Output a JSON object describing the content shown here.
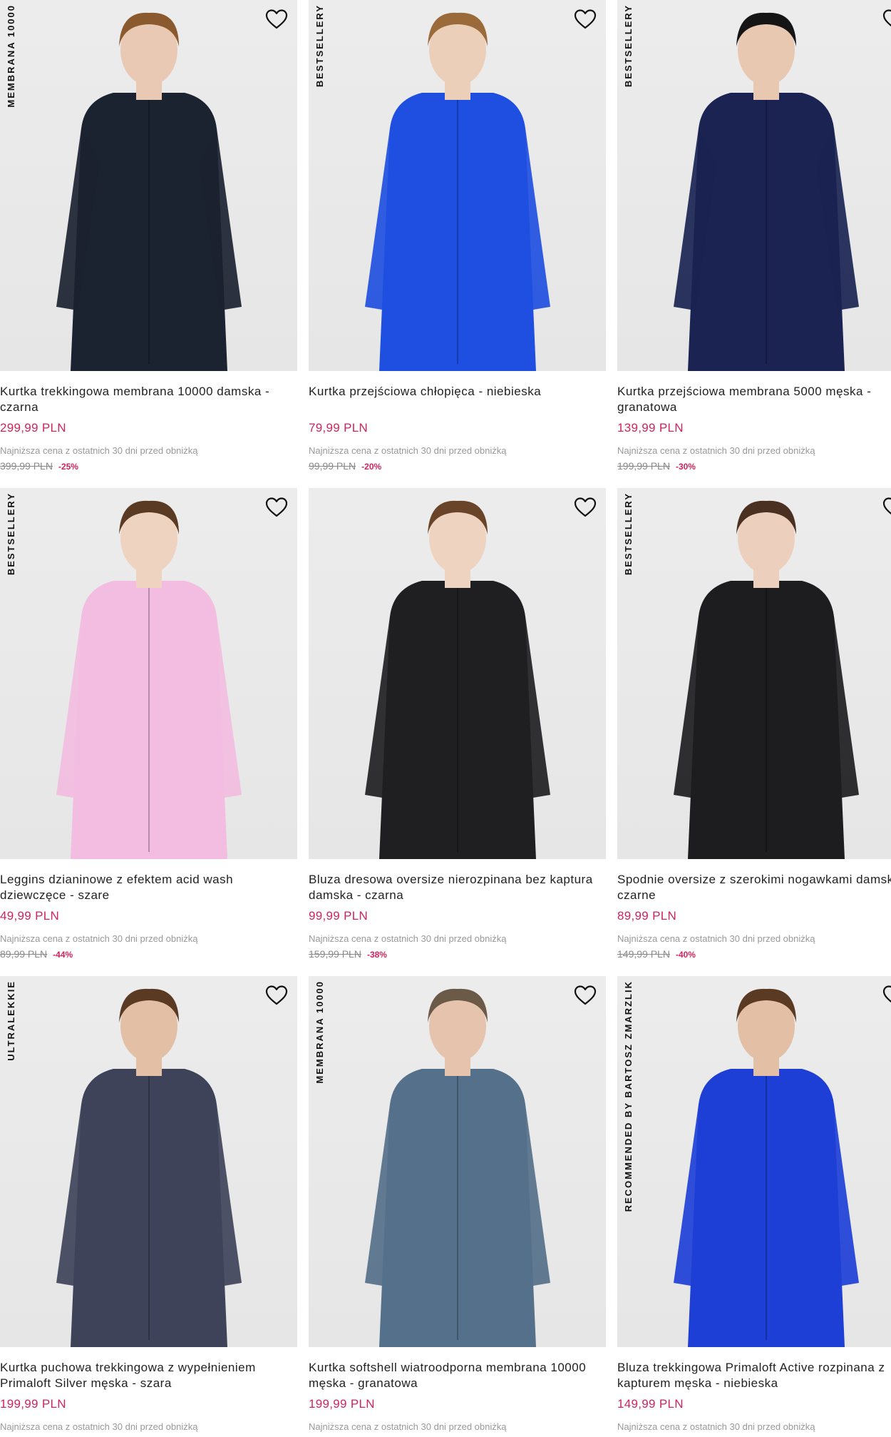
{
  "lowest_price_note": "Najniższa cena z ostatnich 30 dni przed obniżką",
  "products": [
    {
      "tag": "MEMBRANA 10000",
      "title": "Kurtka trekkingowa membrana 10000 damska - czarna",
      "price": "299,99 PLN",
      "old_price": "399,99 PLN",
      "discount": "-25%",
      "garment_color": "#1b2230",
      "skin": "#e9c9b4",
      "hair": "#8a5a2e",
      "pants": "#3d4156"
    },
    {
      "tag": "BESTSELLERY",
      "title": "Kurtka przejściowa chłopięca - niebieska",
      "price": "79,99 PLN",
      "old_price": "99,99 PLN",
      "discount": "-20%",
      "garment_color": "#1f4fe0",
      "skin": "#eccfb9",
      "hair": "#9a6a3a",
      "pants": "#c9c9c9"
    },
    {
      "tag": "BESTSELLERY",
      "title": "Kurtka przejściowa membrana 5000 męska - granatowa",
      "price": "139,99 PLN",
      "old_price": "199,99 PLN",
      "discount": "-30%",
      "garment_color": "#1a2352",
      "skin": "#e8c8b1",
      "hair": "#151515",
      "pants": "#cfcfcf"
    },
    {
      "tag": "BESTSELLERY",
      "title": "Leggins dzianinowe z efektem acid wash dziewczęce - szare",
      "price": "49,99 PLN",
      "old_price": "89,99 PLN",
      "discount": "-44%",
      "garment_color": "#f2bde0",
      "skin": "#efd3c1",
      "hair": "#5a3a22",
      "pants": "#4c5f88"
    },
    {
      "tag": "",
      "title": "Bluza dresowa oversize nierozpinana bez kaptura damska - czarna",
      "price": "99,99 PLN",
      "old_price": "159,99 PLN",
      "discount": "-38%",
      "garment_color": "#1f1f22",
      "skin": "#efd3c1",
      "hair": "#6a4428",
      "pants": "#222226"
    },
    {
      "tag": "BESTSELLERY",
      "title": "Spodnie oversize z szerokimi nogawkami damskie - czarne",
      "price": "89,99 PLN",
      "old_price": "149,99 PLN",
      "discount": "-40%",
      "garment_color": "#1d1d1f",
      "skin": "#ecd0bd",
      "hair": "#4a3020",
      "pants": "#1d1d1f"
    },
    {
      "tag": "ULTRALEKKIE",
      "title": "Kurtka puchowa trekkingowa z wypełnieniem Primaloft Silver męska - szara",
      "price": "199,99 PLN",
      "old_price": "",
      "discount": "",
      "garment_color": "#3e435a",
      "skin": "#e3bfa6",
      "hair": "#5a3a22",
      "pants": "#d0d0d0"
    },
    {
      "tag": "MEMBRANA 10000",
      "title": "Kurtka softshell wiatroodporna membrana 10000 męska - granatowa",
      "price": "199,99 PLN",
      "old_price": "",
      "discount": "",
      "garment_color": "#55708a",
      "skin": "#e6c3ac",
      "hair": "#6b5a48",
      "pants": "#1e2a3a"
    },
    {
      "tag": "RECOMMENDED BY BARTOSZ ZMARZLIK",
      "title": "Bluza trekkingowa Primaloft Active rozpinana z kapturem męska - niebieska",
      "price": "149,99 PLN",
      "old_price": "",
      "discount": "",
      "garment_color": "#1d3fd6",
      "skin": "#e3bfa6",
      "hair": "#5a3a22",
      "pants": "#d3d3d3"
    }
  ]
}
